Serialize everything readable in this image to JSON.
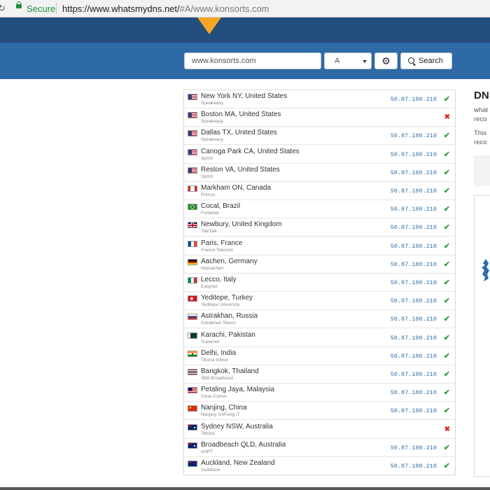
{
  "browser": {
    "secure_label": "Secure",
    "url_main": "https://www.whatsmydns.net/",
    "url_hash": "#A/www.konsorts.com"
  },
  "search": {
    "value": "www.konsorts.com",
    "record_type": "A",
    "button_label": "Search"
  },
  "results": [
    {
      "location": "New York NY, United States",
      "isp": "Speakeasy",
      "ip": "50.87.180.210",
      "status": "ok",
      "flag": "us"
    },
    {
      "location": "Boston MA, United States",
      "isp": "Speakeasy",
      "ip": "",
      "status": "fail",
      "flag": "us"
    },
    {
      "location": "Dallas TX, United States",
      "isp": "Speakeasy",
      "ip": "50.87.180.210",
      "status": "ok",
      "flag": "us"
    },
    {
      "location": "Canoga Park CA, United States",
      "isp": "Sprint",
      "ip": "50.87.180.210",
      "status": "ok",
      "flag": "us"
    },
    {
      "location": "Reston VA, United States",
      "isp": "Sprint",
      "ip": "50.87.180.210",
      "status": "ok",
      "flag": "us"
    },
    {
      "location": "Markham ON, Canada",
      "isp": "Primus",
      "ip": "50.87.180.210",
      "status": "ok",
      "flag": "ca"
    },
    {
      "location": "Cocal, Brazil",
      "isp": "Fortalnet",
      "ip": "50.87.180.210",
      "status": "ok",
      "flag": "br"
    },
    {
      "location": "Newbury, United Kingdom",
      "isp": "TalkTalk",
      "ip": "50.87.180.210",
      "status": "ok",
      "flag": "gb"
    },
    {
      "location": "Paris, France",
      "isp": "France Telecom",
      "ip": "50.87.180.210",
      "status": "ok",
      "flag": "fr"
    },
    {
      "location": "Aachen, Germany",
      "isp": "NetAachen",
      "ip": "50.87.180.210",
      "status": "ok",
      "flag": "de"
    },
    {
      "location": "Lecco, Italy",
      "isp": "Easynet",
      "ip": "50.87.180.210",
      "status": "ok",
      "flag": "it"
    },
    {
      "location": "Yeditepe, Turkey",
      "isp": "Yeditepe University",
      "ip": "50.87.180.210",
      "status": "ok",
      "flag": "tr"
    },
    {
      "location": "Astrakhan, Russia",
      "isp": "Astrakhan Teleco",
      "ip": "50.87.180.210",
      "status": "ok",
      "flag": "ru"
    },
    {
      "location": "Karachi, Pakistan",
      "isp": "Supernet",
      "ip": "50.87.180.210",
      "status": "ok",
      "flag": "pk"
    },
    {
      "location": "Delhi, India",
      "isp": "Tikona Infinet",
      "ip": "50.87.180.210",
      "status": "ok",
      "flag": "in"
    },
    {
      "location": "Bangkok, Thailand",
      "isp": "3BB Broadband",
      "ip": "50.87.180.210",
      "status": "ok",
      "flag": "th"
    },
    {
      "location": "Petaling Jaya, Malaysia",
      "isp": "Clear-Comm",
      "ip": "50.87.180.210",
      "status": "ok",
      "flag": "my"
    },
    {
      "location": "Nanjing, China",
      "isp": "Nanjing XinFeng IT",
      "ip": "50.87.180.210",
      "status": "ok",
      "flag": "cn"
    },
    {
      "location": "Sydney NSW, Australia",
      "isp": "Telstra",
      "ip": "",
      "status": "fail",
      "flag": "au"
    },
    {
      "location": "Broadbeach QLD, Australia",
      "isp": "AAPT",
      "ip": "50.87.180.210",
      "status": "ok",
      "flag": "au"
    },
    {
      "location": "Auckland, New Zealand",
      "isp": "Vodafone",
      "ip": "50.87.180.210",
      "status": "ok",
      "flag": "nz"
    }
  ],
  "sidebar": {
    "title": "DN",
    "text1_line1": "what",
    "text1_line2": "reco",
    "text2_line1": "This",
    "text2_line2": "reco"
  },
  "colors": {
    "header_dark": "#234d7c",
    "header_blue": "#2e6aa6",
    "accent_orange": "#f5a623",
    "ok_green": "#36a03b",
    "fail_red": "#d9302c",
    "ip_blue": "#2f6fa5"
  }
}
